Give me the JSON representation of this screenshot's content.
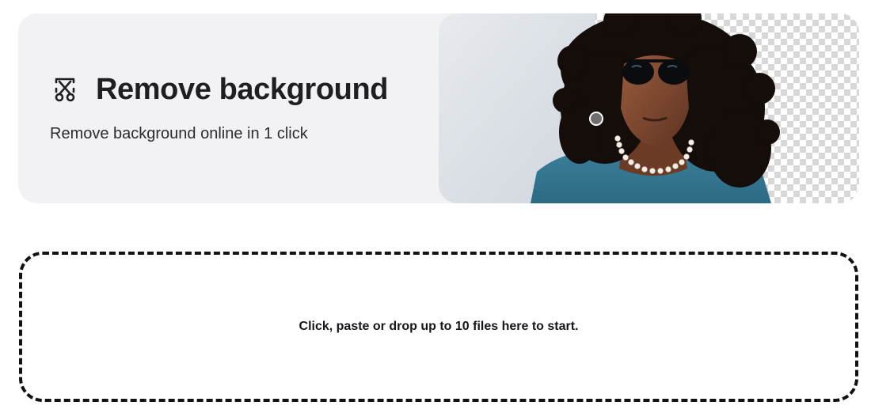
{
  "hero": {
    "title": "Remove background",
    "subtitle": "Remove background online in 1 click",
    "icon": "scissors-icon",
    "preview_image": "person-with-sunglasses-background-removed"
  },
  "dropzone": {
    "text": "Click, paste or drop up to 10 files here to start."
  },
  "colors": {
    "hero_background": "#f2f2f4",
    "dropzone_border": "#111214",
    "text_primary": "#1e1f23"
  }
}
